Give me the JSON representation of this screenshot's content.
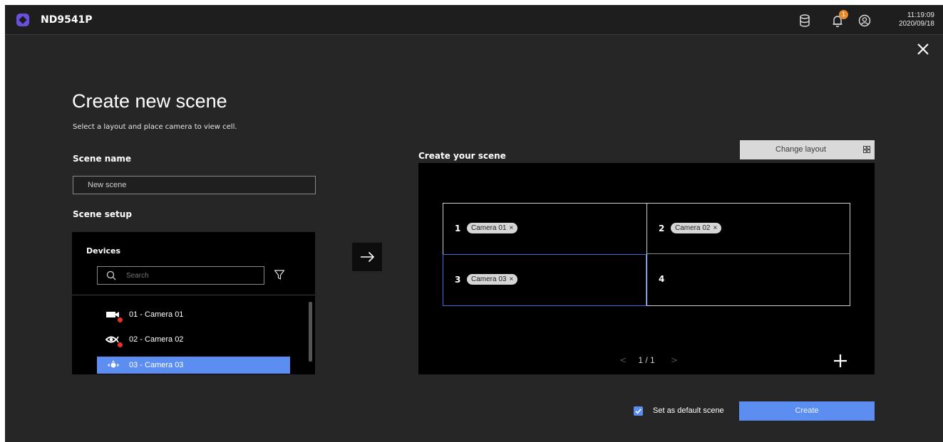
{
  "header": {
    "device_name": "ND9541P",
    "notification_count": "1",
    "time": "11:19:09",
    "date": "2020/09/18",
    "icons": [
      "storage-icon",
      "bell-icon",
      "user-icon"
    ]
  },
  "page": {
    "title": "Create new scene",
    "subtitle": "Select a layout and place camera to view cell.",
    "scene_name_label": "Scene name",
    "scene_name_value": "New scene",
    "scene_setup_label": "Scene setup"
  },
  "devices": {
    "title": "Devices",
    "search_placeholder": "Search",
    "items": [
      {
        "label": "01 - Camera 01",
        "icon": "fixed-camera-icon",
        "status_color": "#e8322a"
      },
      {
        "label": "02 - Camera 02",
        "icon": "fisheye-camera-icon",
        "status_color": "#e8322a"
      },
      {
        "label": "03 - Camera 03",
        "icon": "ptz-camera-icon",
        "selected": true
      }
    ]
  },
  "scene": {
    "title": "Create your scene",
    "change_layout_label": "Change layout",
    "cells": [
      {
        "number": "1",
        "camera": "Camera 01"
      },
      {
        "number": "2",
        "camera": "Camera 02"
      },
      {
        "number": "3",
        "camera": "Camera 03"
      },
      {
        "number": "4",
        "camera": ""
      }
    ],
    "remove_symbol": "×",
    "pager": "1 / 1",
    "pager_prev": "<",
    "pager_next": ">"
  },
  "footer": {
    "default_checked": true,
    "default_label": "Set as default scene",
    "create_label": "Create"
  },
  "colors": {
    "accent": "#5b8ef0",
    "background": "#262626",
    "panel": "#000000",
    "badge": "#e8892b",
    "status_offline": "#e8322a"
  }
}
